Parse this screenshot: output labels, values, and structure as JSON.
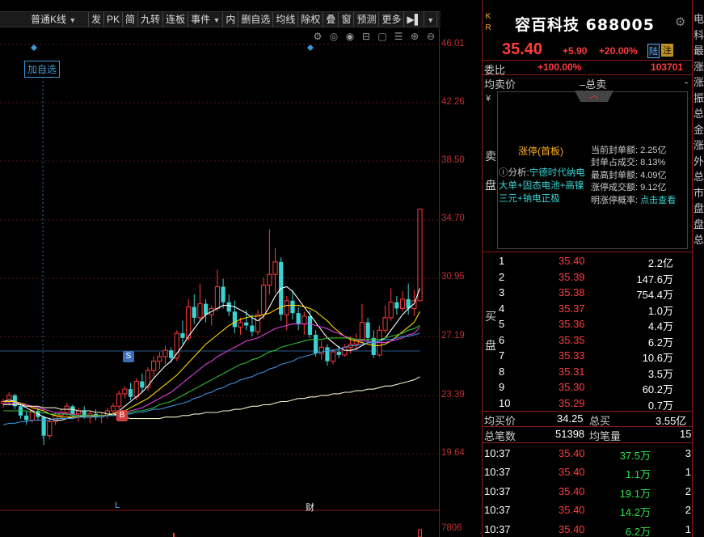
{
  "toolbar": {
    "items": [
      "普通K线",
      "发",
      "PK",
      "简",
      "九转",
      "连板",
      "事件",
      "内",
      "删自选",
      "均线",
      "除权",
      "叠",
      "窗",
      "预测",
      "更多"
    ]
  },
  "chart": {
    "add_watch_label": "加自选",
    "price_ticks": [
      "46.01",
      "42.26",
      "38.50",
      "34.70",
      "30.95",
      "27.19",
      "23.39",
      "19.64"
    ],
    "volume_tick": "7806",
    "marker_l": "L",
    "marker_cai": "财",
    "signal_s": "S",
    "signal_b": "B",
    "icons": [
      "settings-icon",
      "target-icon",
      "eye-icon",
      "basket-icon",
      "window-icon",
      "list-icon",
      "zoom-in-icon",
      "zoom-out-icon"
    ],
    "colors": {
      "up": "#ff3b3b",
      "down": "#3ad3d3",
      "axis": "#8a1a1a"
    }
  },
  "chart_data": {
    "type": "candlestick",
    "ylim": [
      19.64,
      46.01
    ],
    "candles": [
      [
        22.9,
        23.2,
        22.6,
        23.0
      ],
      [
        23.0,
        23.6,
        22.8,
        23.4
      ],
      [
        23.4,
        23.5,
        22.5,
        22.7
      ],
      [
        22.7,
        22.9,
        21.9,
        22.1
      ],
      [
        22.1,
        22.4,
        21.5,
        21.8
      ],
      [
        21.8,
        22.5,
        21.6,
        22.4
      ],
      [
        22.4,
        22.6,
        21.8,
        22.0
      ],
      [
        22.0,
        22.1,
        20.2,
        20.8
      ],
      [
        20.8,
        21.9,
        20.6,
        21.7
      ],
      [
        21.7,
        22.3,
        21.5,
        22.1
      ],
      [
        22.1,
        22.5,
        21.9,
        22.3
      ],
      [
        22.3,
        22.9,
        22.1,
        22.7
      ],
      [
        22.7,
        22.8,
        22.0,
        22.2
      ],
      [
        22.2,
        22.6,
        21.7,
        22.4
      ],
      [
        22.4,
        22.7,
        21.9,
        22.0
      ],
      [
        22.0,
        22.4,
        21.6,
        22.2
      ],
      [
        22.2,
        22.5,
        21.8,
        22.0
      ],
      [
        22.0,
        22.3,
        21.6,
        22.1
      ],
      [
        22.1,
        22.6,
        21.9,
        22.4
      ],
      [
        22.4,
        22.9,
        22.2,
        22.7
      ],
      [
        22.7,
        23.7,
        22.5,
        23.5
      ],
      [
        23.5,
        24.0,
        23.2,
        23.8
      ],
      [
        23.8,
        24.2,
        23.1,
        23.3
      ],
      [
        23.3,
        24.5,
        23.1,
        24.3
      ],
      [
        24.3,
        24.8,
        23.6,
        23.9
      ],
      [
        23.9,
        25.2,
        23.7,
        25.0
      ],
      [
        25.0,
        25.9,
        24.6,
        25.6
      ],
      [
        25.6,
        26.2,
        25.1,
        25.9
      ],
      [
        25.9,
        26.6,
        25.4,
        26.3
      ],
      [
        26.3,
        26.5,
        25.5,
        25.8
      ],
      [
        25.8,
        27.6,
        25.6,
        27.4
      ],
      [
        27.4,
        28.2,
        26.7,
        27.1
      ],
      [
        27.1,
        29.6,
        26.9,
        29.1
      ],
      [
        29.1,
        29.9,
        28.0,
        28.4
      ],
      [
        28.4,
        30.6,
        28.2,
        29.3
      ],
      [
        29.3,
        29.6,
        28.1,
        28.6
      ],
      [
        28.6,
        29.2,
        27.9,
        29.0
      ],
      [
        29.0,
        31.5,
        28.8,
        30.4
      ],
      [
        30.4,
        30.9,
        29.0,
        29.4
      ],
      [
        29.4,
        29.9,
        28.5,
        28.8
      ],
      [
        28.8,
        29.5,
        27.4,
        27.8
      ],
      [
        27.8,
        28.4,
        27.3,
        28.1
      ],
      [
        28.1,
        28.9,
        27.6,
        27.9
      ],
      [
        27.9,
        28.6,
        27.2,
        27.5
      ],
      [
        27.5,
        28.9,
        27.3,
        28.6
      ],
      [
        28.6,
        31.0,
        28.3,
        30.5
      ],
      [
        30.5,
        34.1,
        29.9,
        31.2
      ],
      [
        31.2,
        32.9,
        30.0,
        32.0
      ],
      [
        32.0,
        32.3,
        28.2,
        28.6
      ],
      [
        28.6,
        29.8,
        27.6,
        29.5
      ],
      [
        29.5,
        30.2,
        28.3,
        28.7
      ],
      [
        28.7,
        29.1,
        27.6,
        28.0
      ],
      [
        28.0,
        28.8,
        27.3,
        28.5
      ],
      [
        28.5,
        28.9,
        27.1,
        27.3
      ],
      [
        27.3,
        27.6,
        25.9,
        26.1
      ],
      [
        26.1,
        26.9,
        25.7,
        26.5
      ],
      [
        26.5,
        26.7,
        25.3,
        25.6
      ],
      [
        25.6,
        26.4,
        25.4,
        26.2
      ],
      [
        26.2,
        26.6,
        25.8,
        26.0
      ],
      [
        26.0,
        26.7,
        25.9,
        26.5
      ],
      [
        26.5,
        27.2,
        26.1,
        26.7
      ],
      [
        26.7,
        27.4,
        26.3,
        27.0
      ],
      [
        27.0,
        29.3,
        26.8,
        28.1
      ],
      [
        28.1,
        28.4,
        26.8,
        27.1
      ],
      [
        27.1,
        27.6,
        25.8,
        26.0
      ],
      [
        26.0,
        27.9,
        25.9,
        27.6
      ],
      [
        27.6,
        29.2,
        27.4,
        28.4
      ],
      [
        28.4,
        30.3,
        28.2,
        29.4
      ],
      [
        29.4,
        29.8,
        28.6,
        29.0
      ],
      [
        29.0,
        30.1,
        28.8,
        29.6
      ],
      [
        29.6,
        30.6,
        28.6,
        29.0
      ],
      [
        29.0,
        30.2,
        28.5,
        29.5
      ],
      [
        29.5,
        35.4,
        29.5,
        35.4
      ]
    ],
    "ma": [
      {
        "name": "",
        "color": "#ffffff",
        "values": [
          23.0,
          23.1,
          23.0,
          22.8,
          22.6,
          22.4,
          22.2,
          22.0,
          21.9,
          21.8,
          21.8,
          21.9,
          22.0,
          22.0,
          22.1,
          22.1,
          22.1,
          22.1,
          22.1,
          22.2,
          22.4,
          22.7,
          23.0,
          23.3,
          23.6,
          24.0,
          24.5,
          24.9,
          25.3,
          25.6,
          26.1,
          26.6,
          27.2,
          27.7,
          28.2,
          28.6,
          28.8,
          29.0,
          29.2,
          29.2,
          29.1,
          28.9,
          28.7,
          28.4,
          28.2,
          28.5,
          29.1,
          29.8,
          30.3,
          30.4,
          30.1,
          29.6,
          29.1,
          28.6,
          28.1,
          27.6,
          27.1,
          26.8,
          26.5,
          26.3,
          26.3,
          26.4,
          26.6,
          26.8,
          26.8,
          26.9,
          27.1,
          27.6,
          28.1,
          28.6,
          29.0,
          29.3,
          30.3
        ]
      },
      {
        "name": "",
        "color": "#ffd700",
        "values": [
          23.0,
          23.0,
          23.0,
          22.9,
          22.8,
          22.6,
          22.5,
          22.4,
          22.2,
          22.1,
          22.0,
          22.0,
          22.0,
          22.0,
          22.0,
          22.0,
          22.1,
          22.1,
          22.1,
          22.2,
          22.3,
          22.4,
          22.6,
          22.8,
          23.0,
          23.2,
          23.5,
          23.8,
          24.1,
          24.4,
          24.7,
          25.1,
          25.5,
          25.9,
          26.3,
          26.7,
          27.0,
          27.3,
          27.6,
          27.9,
          28.1,
          28.3,
          28.4,
          28.5,
          28.5,
          28.6,
          28.7,
          28.9,
          29.1,
          29.2,
          29.2,
          29.2,
          29.1,
          29.0,
          28.8,
          28.5,
          28.2,
          27.8,
          27.5,
          27.2,
          27.0,
          26.9,
          26.8,
          26.7,
          26.6,
          26.6,
          26.7,
          26.9,
          27.2,
          27.5,
          27.8,
          28.1,
          28.8
        ]
      },
      {
        "name": "",
        "color": "#e040e0",
        "values": [
          22.9,
          22.9,
          22.9,
          22.8,
          22.8,
          22.7,
          22.6,
          22.5,
          22.4,
          22.3,
          22.3,
          22.2,
          22.2,
          22.1,
          22.1,
          22.1,
          22.1,
          22.1,
          22.1,
          22.1,
          22.2,
          22.3,
          22.4,
          22.5,
          22.6,
          22.8,
          23.0,
          23.2,
          23.4,
          23.6,
          23.9,
          24.2,
          24.5,
          24.8,
          25.1,
          25.4,
          25.6,
          25.9,
          26.1,
          26.3,
          26.5,
          26.7,
          26.9,
          27.0,
          27.1,
          27.3,
          27.5,
          27.7,
          27.8,
          27.9,
          28.0,
          28.0,
          28.0,
          28.0,
          27.9,
          27.8,
          27.7,
          27.5,
          27.4,
          27.2,
          27.1,
          27.0,
          26.9,
          26.9,
          26.8,
          26.8,
          26.8,
          26.9,
          27.0,
          27.1,
          27.3,
          27.4,
          27.8
        ]
      },
      {
        "name": "",
        "color": "#30c030",
        "values": [
          22.4,
          22.4,
          22.4,
          22.4,
          22.4,
          22.3,
          22.3,
          22.3,
          22.2,
          22.2,
          22.2,
          22.2,
          22.1,
          22.1,
          22.1,
          22.1,
          22.1,
          22.1,
          22.1,
          22.1,
          22.2,
          22.2,
          22.3,
          22.4,
          22.4,
          22.5,
          22.6,
          22.8,
          22.9,
          23.0,
          23.2,
          23.4,
          23.6,
          23.8,
          24.0,
          24.2,
          24.4,
          24.6,
          24.8,
          25.0,
          25.2,
          25.4,
          25.5,
          25.7,
          25.8,
          26.0,
          26.2,
          26.3,
          26.5,
          26.6,
          26.7,
          26.8,
          26.9,
          27.0,
          27.0,
          27.0,
          27.1,
          27.1,
          27.1,
          27.1,
          27.1,
          27.0,
          27.0,
          27.0,
          27.0,
          27.0,
          27.1,
          27.2,
          27.3,
          27.4,
          27.6,
          27.7,
          27.9
        ]
      },
      {
        "name": "",
        "color": "#3a8fd8",
        "values": [
          21.5,
          21.6,
          21.6,
          21.7,
          21.7,
          21.8,
          21.8,
          21.8,
          21.8,
          21.9,
          21.9,
          21.9,
          21.9,
          22.0,
          22.0,
          22.0,
          22.0,
          22.0,
          22.1,
          22.1,
          22.1,
          22.2,
          22.2,
          22.3,
          22.3,
          22.4,
          22.5,
          22.5,
          22.6,
          22.7,
          22.8,
          22.9,
          23.0,
          23.2,
          23.3,
          23.5,
          23.6,
          23.8,
          23.9,
          24.1,
          24.2,
          24.4,
          24.5,
          24.6,
          24.8,
          24.9,
          25.1,
          25.2,
          25.4,
          25.5,
          25.6,
          25.8,
          25.9,
          26.0,
          26.1,
          26.2,
          26.3,
          26.3,
          26.4,
          26.5,
          26.6,
          26.6,
          26.7,
          26.8,
          26.8,
          26.9,
          27.0,
          27.0,
          27.1,
          27.2,
          27.2,
          27.3,
          27.4
        ]
      },
      {
        "name": "",
        "color": "#f5f0c8",
        "values": [
          22.8,
          22.8,
          22.8,
          22.8,
          22.7,
          22.7,
          22.7,
          22.6,
          22.6,
          22.6,
          22.5,
          22.5,
          22.5,
          22.4,
          22.4,
          22.4,
          22.3,
          22.3,
          22.2,
          22.2,
          22.1,
          22.0,
          21.9,
          21.9,
          21.9,
          21.9,
          21.9,
          21.9,
          22.0,
          22.0,
          22.0,
          22.1,
          22.1,
          22.2,
          22.2,
          22.3,
          22.3,
          22.3,
          22.4,
          22.4,
          22.5,
          22.5,
          22.6,
          22.7,
          22.7,
          22.8,
          22.8,
          22.9,
          23.0,
          23.0,
          23.1,
          23.2,
          23.2,
          23.3,
          23.3,
          23.4,
          23.4,
          23.5,
          23.5,
          23.6,
          23.6,
          23.7,
          23.7,
          23.8,
          23.8,
          23.9,
          24.0,
          24.0,
          24.1,
          24.2,
          24.3,
          24.4,
          24.6
        ]
      }
    ]
  },
  "quote": {
    "kr": "K R",
    "name": "容百科技 688005",
    "price": "35.40",
    "change": "+5.90",
    "change_pct": "+20.00%",
    "badge1": "陆",
    "badge2": "注",
    "weibi_label": "委比",
    "weibi_value": "+100.00%",
    "weicha_value": "103701",
    "avg_sell_label": "均卖价",
    "total_sell_label": "–总卖",
    "total_sell_dash": "-",
    "yen": "¥",
    "sell_side_1": "卖",
    "sell_side_2": "盘",
    "limit_title": "涨停(首板)",
    "analysis_prefix": "ⓘ分析:",
    "analysis_text": "宁德时代纳电大单+固态电池+高镍三元+钠电正极",
    "stats": [
      {
        "label": "当前封单额:",
        "value": "2.25亿"
      },
      {
        "label": "封单占成交:",
        "value": "8.13%"
      },
      {
        "label": "最高封单额:",
        "value": "4.09亿"
      },
      {
        "label": "涨停成交额:",
        "value": "9.12亿"
      },
      {
        "label": "明涨停概率:",
        "value": "点击查看"
      }
    ],
    "buy_side_1": "买",
    "buy_side_2": "盘",
    "buy_levels": [
      {
        "n": "1",
        "p": "35.40",
        "v": "2.2亿"
      },
      {
        "n": "2",
        "p": "35.39",
        "v": "147.6万"
      },
      {
        "n": "3",
        "p": "35.38",
        "v": "754.4万"
      },
      {
        "n": "4",
        "p": "35.37",
        "v": "1.0万"
      },
      {
        "n": "5",
        "p": "35.36",
        "v": "4.4万"
      },
      {
        "n": "6",
        "p": "35.35",
        "v": "6.2万"
      },
      {
        "n": "7",
        "p": "35.33",
        "v": "10.6万"
      },
      {
        "n": "8",
        "p": "35.31",
        "v": "3.5万"
      },
      {
        "n": "9",
        "p": "35.30",
        "v": "60.2万"
      },
      {
        "n": "10",
        "p": "35.29",
        "v": "0.7万"
      }
    ],
    "avg_buy_label": "均买价",
    "avg_buy_value": "34.25",
    "total_buy_label": "总买",
    "total_buy_value": "3.55亿",
    "total_trades_label": "总笔数",
    "total_trades_value": "51398",
    "avg_trades_label": "均笔量",
    "avg_trades_value": "15",
    "trades": [
      {
        "t": "10:37",
        "p": "35.40",
        "v": "37.5万",
        "c": "3"
      },
      {
        "t": "10:37",
        "p": "35.40",
        "v": "1.1万",
        "c": "1"
      },
      {
        "t": "10:37",
        "p": "35.40",
        "v": "19.1万",
        "c": "2"
      },
      {
        "t": "10:37",
        "p": "35.40",
        "v": "14.2万",
        "c": "2"
      },
      {
        "t": "10:37",
        "p": "35.40",
        "v": "6.2万",
        "c": "1"
      }
    ],
    "side_strip": "电科最涨涨振总金涨外总市盘盘总"
  }
}
